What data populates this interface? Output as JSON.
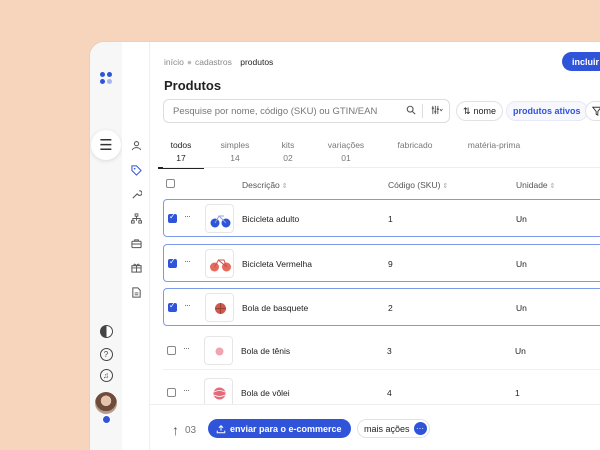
{
  "breadcrumbs": [
    "início",
    "cadastros",
    "produtos"
  ],
  "header": {
    "title": "Produtos",
    "include_label": "incluir"
  },
  "search": {
    "placeholder": "Pesquise por nome, código (SKU) ou GTIN/EAN"
  },
  "filters": {
    "sort_label": "nome",
    "status_label": "produtos ativos"
  },
  "tabs": [
    {
      "label": "todos",
      "count": "17"
    },
    {
      "label": "simples",
      "count": "14"
    },
    {
      "label": "kits",
      "count": "02"
    },
    {
      "label": "variações",
      "count": "01"
    },
    {
      "label": "fabricado",
      "count": ""
    },
    {
      "label": "matéria-prima",
      "count": ""
    }
  ],
  "table": {
    "columns": [
      "Descrição",
      "Código (SKU)",
      "Unidade"
    ],
    "rows": [
      {
        "name": "Bicicleta adulto",
        "sku": "1",
        "unit": "Un",
        "selected": true,
        "thumb": "blue-bicycle"
      },
      {
        "name": "Bicicleta Vermelha",
        "sku": "9",
        "unit": "Un",
        "selected": true,
        "thumb": "red-bicycle"
      },
      {
        "name": "Bola de basquete",
        "sku": "2",
        "unit": "Un",
        "selected": true,
        "thumb": "basketball"
      },
      {
        "name": "Bola de tênis",
        "sku": "3",
        "unit": "Un",
        "selected": false,
        "thumb": "tennis-ball"
      },
      {
        "name": "Bola de vôlei",
        "sku": "4",
        "unit": "1",
        "selected": false,
        "thumb": "volleyball"
      }
    ]
  },
  "footer": {
    "selected_count": "03",
    "send_label": "enviar para o e-commerce",
    "more_label": "mais ações"
  },
  "colors": {
    "accent": "#2f54d9",
    "background": "#f6d5bc"
  },
  "icons": [
    "logo-icon",
    "menu-icon",
    "user-icon",
    "tag-icon",
    "wrench-icon",
    "sitemap-icon",
    "briefcase-icon",
    "gift-icon",
    "document-icon",
    "contrast-icon",
    "help-icon",
    "bell-icon",
    "search-icon",
    "filter-icon",
    "sort-icon",
    "upload-icon",
    "arrow-up-icon"
  ]
}
